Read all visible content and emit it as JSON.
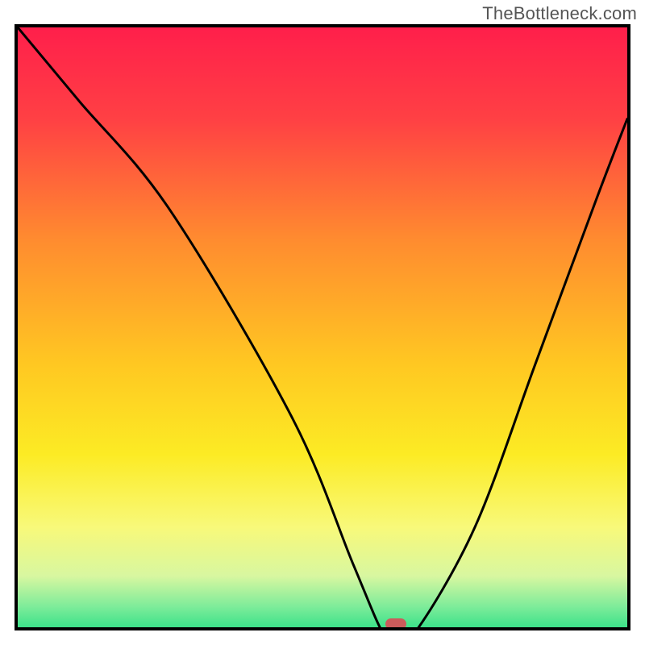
{
  "watermark": "TheBottleneck.com",
  "chart_data": {
    "type": "line",
    "title": "",
    "xlabel": "",
    "ylabel": "",
    "xlim": [
      0,
      100
    ],
    "ylim": [
      0,
      100
    ],
    "series": [
      {
        "name": "bottleneck-curve",
        "x": [
          0,
          10,
          25,
          45,
          55,
          60,
          62,
          65,
          75,
          85,
          95,
          100
        ],
        "values": [
          100,
          88,
          70,
          36,
          12,
          0.5,
          0.5,
          0.5,
          18,
          45,
          72,
          85
        ]
      }
    ],
    "markers": [
      {
        "name": "optimal-point",
        "x": 62,
        "y": 0.5,
        "color": "#cc5b5b"
      }
    ],
    "background_gradient": {
      "stops": [
        {
          "offset": 0.0,
          "color": "#ff1f4b"
        },
        {
          "offset": 0.15,
          "color": "#ff4044"
        },
        {
          "offset": 0.35,
          "color": "#ff8c2f"
        },
        {
          "offset": 0.55,
          "color": "#ffc722"
        },
        {
          "offset": 0.7,
          "color": "#fceb24"
        },
        {
          "offset": 0.82,
          "color": "#f8f97a"
        },
        {
          "offset": 0.9,
          "color": "#d8f7a0"
        },
        {
          "offset": 0.95,
          "color": "#7eec9a"
        },
        {
          "offset": 1.0,
          "color": "#1fdd82"
        }
      ]
    },
    "colors": {
      "curve_stroke": "#000000",
      "border": "#000000"
    }
  }
}
